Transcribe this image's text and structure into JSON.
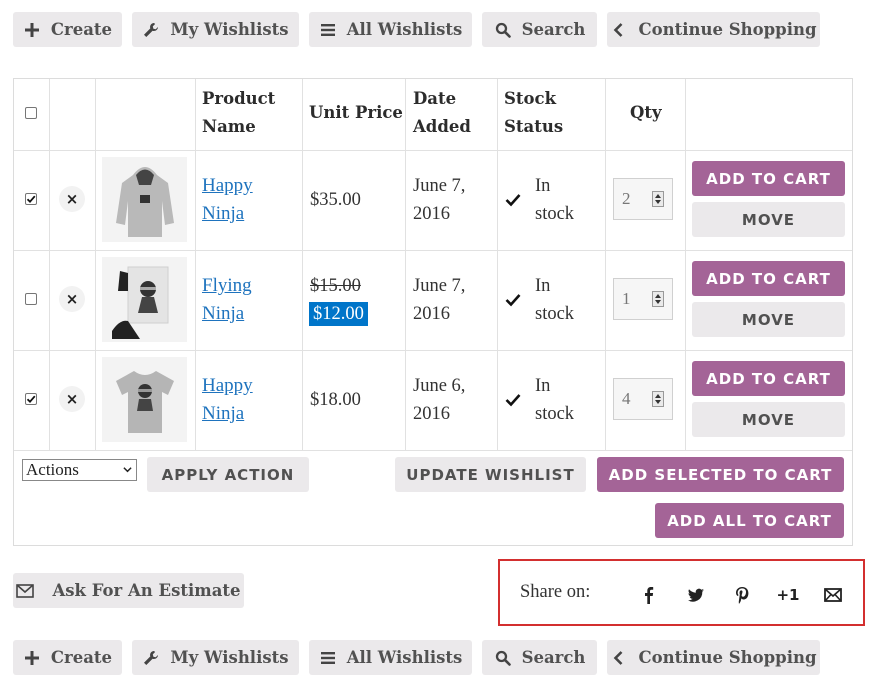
{
  "nav": {
    "create": "Create",
    "my_wishlists": "My Wishlists",
    "all_wishlists": "All Wishlists",
    "search": "Search",
    "continue_shopping": "Continue Shopping"
  },
  "table": {
    "headers": {
      "product_name_line1": "Product",
      "product_name_line2": "Name",
      "unit_price": "Unit Price",
      "date_added_line1": "Date",
      "date_added_line2": "Added",
      "stock_status_line1": "Stock",
      "stock_status_line2": "Status",
      "qty": "Qty"
    },
    "rows": [
      {
        "checked": true,
        "name_line1": "Happy",
        "name_line2": "Ninja",
        "price": "$35.00",
        "date_line1": "June 7,",
        "date_line2": "2016",
        "stock_line1": "In",
        "stock_line2": "stock",
        "qty": "2",
        "thumb": "hoodie-icon"
      },
      {
        "checked": false,
        "name_line1": "Flying",
        "name_line2": "Ninja",
        "price_old": "$15.00",
        "price_sale": "$12.00",
        "date_line1": "June 7,",
        "date_line2": "2016",
        "stock_line1": "In",
        "stock_line2": "stock",
        "qty": "1",
        "thumb": "poster-icon"
      },
      {
        "checked": true,
        "name_line1": "Happy",
        "name_line2": "Ninja",
        "price": "$18.00",
        "date_line1": "June 6,",
        "date_line2": "2016",
        "stock_line1": "In",
        "stock_line2": "stock",
        "qty": "4",
        "thumb": "tshirt-icon"
      }
    ],
    "row_buttons": {
      "add_to_cart": "ADD TO CART",
      "move": "MOVE"
    },
    "footer": {
      "actions_select": "Actions",
      "apply_action": "APPLY ACTION",
      "update_wishlist": "UPDATE WISHLIST",
      "add_selected": "ADD SELECTED TO CART",
      "add_all": "ADD ALL TO CART"
    }
  },
  "ask_estimate": "Ask For An Estimate",
  "share": {
    "label": "Share on:",
    "gplus": "+1",
    "icons": [
      "facebook-icon",
      "twitter-icon",
      "pinterest-icon",
      "googleplus-icon",
      "email-icon"
    ]
  },
  "colors": {
    "purple": "#a46497",
    "gray_button": "#ebe9eb",
    "link": "#1e73be",
    "sale_bg": "#0075c9",
    "highlight_border": "#d32f2f"
  }
}
